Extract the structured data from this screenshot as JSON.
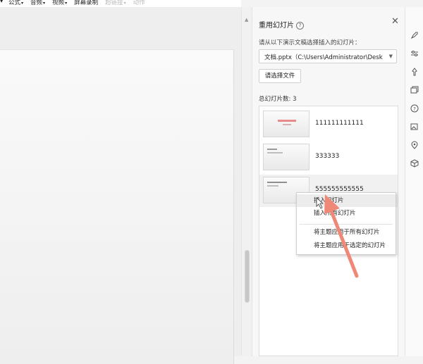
{
  "menu": {
    "items": [
      {
        "label": "公式",
        "caret": true,
        "dim": false
      },
      {
        "label": "音频",
        "caret": true,
        "dim": false
      },
      {
        "label": "视频",
        "caret": true,
        "dim": false
      },
      {
        "label": "屏幕录制",
        "caret": false,
        "dim": false
      },
      {
        "label": "超链接",
        "caret": true,
        "dim": true
      },
      {
        "label": "动作",
        "caret": false,
        "dim": true
      }
    ]
  },
  "pane": {
    "title": "重用幻灯片",
    "prompt": "请从以下演示文稿选择插入的幻灯片：",
    "file_value": "文档.pptx（C:\\Users\\Administrator\\Desk",
    "browse_label": "请选择文件",
    "count_label": "总幻灯片数: 3",
    "slides": [
      {
        "label": "111111111111"
      },
      {
        "label": "333333"
      },
      {
        "label": "555555555555"
      }
    ]
  },
  "context_menu": {
    "items": [
      {
        "label": "插入幻灯片"
      },
      {
        "label": "插入所有幻灯片"
      },
      {
        "label": "将主题应用于所有幻灯片"
      },
      {
        "label": "将主题应用于选定的幻灯片"
      }
    ],
    "highlighted_index": 0
  },
  "rail": {
    "icons": [
      "rocket-icon",
      "sliders-icon",
      "pin-icon",
      "slides-icon",
      "help-icon",
      "image-edit-icon",
      "location-icon",
      "cube-icon"
    ]
  },
  "colors": {
    "annotation_arrow": "#f08878",
    "accent_title_thumb": "#e88a8a"
  }
}
